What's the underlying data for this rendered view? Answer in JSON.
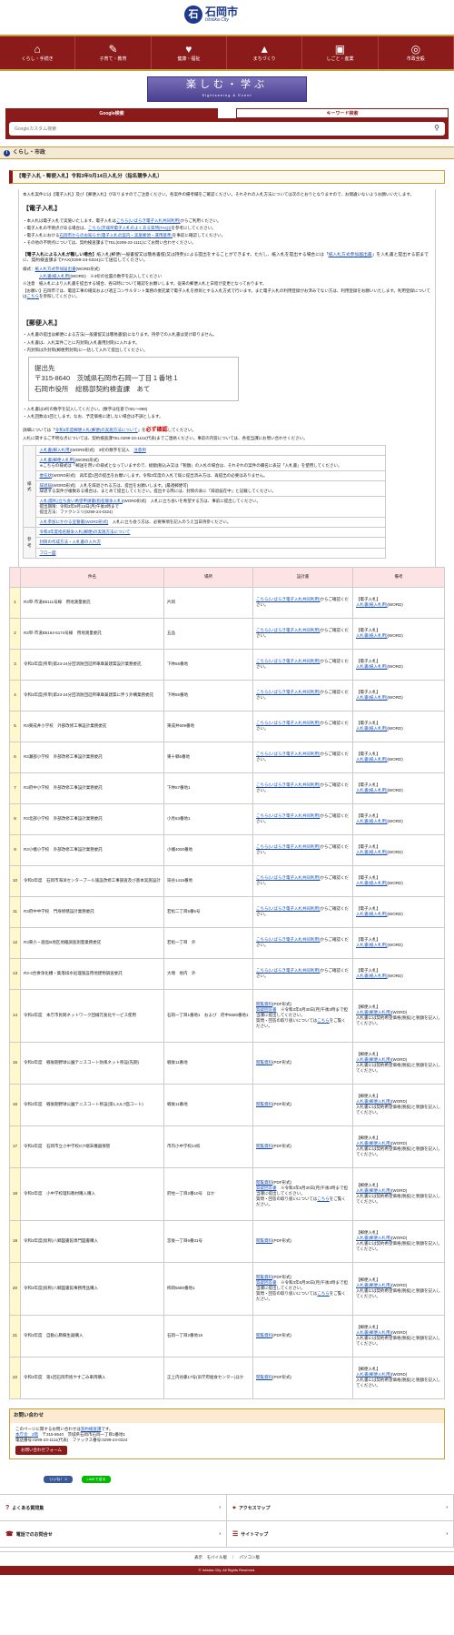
{
  "header": {
    "logo_mark": "石",
    "logo_jp": "石岡市",
    "logo_en": "Ishioka City"
  },
  "nav": [
    {
      "label": "くらし・手続き",
      "icon": "⌂"
    },
    {
      "label": "子育て・教育",
      "icon": "✎"
    },
    {
      "label": "健康・福祉",
      "icon": "♥"
    },
    {
      "label": "まちづくり",
      "icon": "▲"
    },
    {
      "label": "しごと・産業",
      "icon": "▣"
    },
    {
      "label": "市政全般",
      "icon": "◎"
    }
  ],
  "banner": {
    "title": "楽しむ・学ぶ",
    "sub": "Sightseeing & Event"
  },
  "search": {
    "tab1": "Google検索",
    "tab2": "キーワード検索",
    "placeholder": "Googleカスタム検索"
  },
  "breadcrumb": "くらし・市政",
  "page_title": "【電子入札・郵便入札】令和3年9月14日入札分（指名競争入札）",
  "intro": "本入札案件には【電子入札】及び【郵便入札】がありますのでご注意ください。各案件の備考欄をご確認ください。それぞれの入札方法については次のとおりとなりますので、お間違いないようお願いいたします。",
  "denshi": {
    "heading": "【電子入札】",
    "l1": "・本入札は電子入札で実施いたします。電子入札は",
    "l1_link": "こちら(いばらき電子入札共同利用)",
    "l1_tail": "からご利用ください。",
    "l2": "・電子入札の不明点がある場合は、",
    "l2_link": "こちら(茨城県電子入札のよくある質問(FAQ))",
    "l2_tail": "を参考にしてください。",
    "l3": "・電子入札における",
    "l3_link": "石岡市からのお知らせ(電子入札の案内・実施要領・運用基準)",
    "l3_tail": "を事前に確認してください。",
    "l4": "・その他の不明点については、契約検査課までTEL(0299-23-1111)にてお問い合わせください。",
    "k1": "【電子入札による入札が難しい場合】",
    "k1b": "紙入札(郵便(一般書留又は簡易書留)又は持参)による提出をすることができます。ただし、紙入札を提出する場合には「",
    "k1_link": "紙入札方式参加届出書",
    "k1c": "」を入札書と提出する前までに、契約検査課までFAX(0299-24-0324)にて送信してください。",
    "k2": "様式：",
    "k2_link": "紙入札方式参加届出書",
    "k2_tail": "(WORD形式)",
    "k3_link": "入札書(紙入札用)",
    "k3_tail": "(WORD)　※3桁の位置の数字を記入してください",
    "k4": "※注意　紙入札により入札書を提出する場合、各日時について確認をお願いします。従来の郵便入札と日程が変更となっております。",
    "k5": "【お願い】石岡市では、電話工事の確実および適正コンサルタント業務の委託業で電子入札を原則とする入札方式で行います。",
    "k5b": "また電子入札の利用登録がお済みでない方は、利用登録をお願いいたします。利用登録については",
    "k5_link": "こちら",
    "k5_tail": "を参照してください。"
  },
  "yubin": {
    "heading": "【郵便入札】",
    "l1": "・入札書の提出は郵便による方法(一般書留又は簡易書留)になります。持参での入札書は受け取りません。",
    "l2": "・入札書は、入札案件ごとに内封筒(入札書用封筒)に入れます。",
    "l3": "・内封筒は外封筒(郵便用封筒)に一括して入れて提出してください。",
    "addr1": "提出先",
    "addr2": "〒315-8640　茨城県石岡市石岡一丁目１番地１",
    "addr3": "石岡市役所　総務部契約検査課　あて",
    "l4": "・入札書は3桁の数字を記入してください。(数字は任意で001～999)",
    "l5": "・入札回数は1回とします。なお、予定価格に達しない場合は不調とします。",
    "l6": "詳細については「",
    "l6_link": "令和3年度郵便入札(郵便)の実施方法について",
    "l6_tail": "」を",
    "l6_red": "必ず確認",
    "l6_end": "してください。",
    "l7": "入札に関するご不明な点については、契約検査課TEL:0299-23-1111(代表)までご連絡ください。事前の内容については、各担当課にお問い合わせください。"
  },
  "forms": {
    "h1": "様式",
    "h2": "参考",
    "r1_link": "入札書(郵入札用)",
    "r1_tail": "(WORD形式)　3桁の数字を記入",
    "r1_link2": "注意例",
    "r2_link": "入札書(郵便入札用)",
    "r2_tail": "(WORD形式)",
    "r2_note": "※こちらの様式は「郵送を用いの様式となっていますので、総額(税込み又は「税額」の入札の場合は、それぞれの案件の欄名に表記「入札書」を使用してください。",
    "r3_link": "委任状",
    "r3_tail": "(WORD形式)　再年度1回の提出をお願いします。令和3年度の入札で既に提出済み方は、再提出の必要はありません。",
    "r4_link": "辞退届",
    "r4_tail": "(WORD形式)　入札を辞退される方は、提出をお願いします。(最適郵便可)",
    "r4_note": "辞退する案件が複数ある場合は、まとめて提出してください。提出する際には、封筒の表に「辞退届在中」と記載してください。",
    "r5_link": "入札(開札)立ち会い希望申請書(指名競争入札)",
    "r5_tail": "(WORD形式)　入札に立ち会いを希望する方は、事前に提出してください。",
    "r5_date": "提出期限：令和3年9月13日(月)午後3時まで",
    "r5_fax": "提出方法：ファクシミリ(0299-24-0324)",
    "r6_link": "入札参加にかかる宣誓書(WORD形式)",
    "r6_tail": "入札に立ち会う方は、必要事項を記入のうえ当日持参ください。",
    "ref1": "令和3年度指名競争入札(郵便)の実施方法について",
    "ref2": "封筒の作成方法・入札書の入れ方",
    "ref3": "フロー図"
  },
  "table": {
    "headers": [
      "",
      "件名",
      "場所",
      "設計書",
      "備考"
    ],
    "design_link": "こちら(いばらき電子入札共同利用)",
    "design_tail": "からご確認ください。",
    "doc_link": "閲覧資料",
    "doc_tail": "(PDF形式)",
    "q_link": "質疑回答書",
    "q_tail": "※令和3年8月30日(月)午後3時まで担当課に提出してください。",
    "q_more": "質問・回答の取り扱いについては",
    "q_more_link": "こちら",
    "q_more_tail": "をご覧ください。",
    "e_tag": "【電子入札】",
    "y_tag": "【郵便入札】",
    "e_link": "入札書(紙入札用)",
    "y_link": "入札書(郵便入札用)",
    "word": "(WORD)",
    "y_note": "入札書には契約希望価格(税抜)と税額を記入してください。",
    "rows": [
      {
        "no": "1",
        "name": "R3単-市道B0111号線　用地測量委託",
        "place": "片岡",
        "t": "e"
      },
      {
        "no": "2",
        "name": "R3単-市道B5164-5174号線　用地測量委託",
        "place": "五品",
        "t": "e"
      },
      {
        "no": "3",
        "name": "令和3年度(県単)第23-24分団消防団詰所車庫兼建築設計業務委託",
        "place": "下林55番地",
        "t": "e"
      },
      {
        "no": "4",
        "name": "令和3年度(県単)第23-24分団消防団詰所車庫兼建築に伴う外構業務委託",
        "place": "下林55番地",
        "t": "e"
      },
      {
        "no": "5",
        "name": "R3東成井小学校　外部改修工事設計業務委託",
        "place": "東成井609番地",
        "t": "e"
      },
      {
        "no": "6",
        "name": "R3瀬部小学校　外部改修工事設計業務委託",
        "place": "東十郷6番地",
        "t": "e"
      },
      {
        "no": "7",
        "name": "R3府中小学校　外部改修工事設計業務委託",
        "place": "下林57番地1",
        "t": "e"
      },
      {
        "no": "8",
        "name": "R3北部小学校　外部改修工事設計業務委託",
        "place": "小見63番地1",
        "t": "e"
      },
      {
        "no": "9",
        "name": "R3小幡小学校　外部改修工事設計業務委託",
        "place": "小幡4000番地",
        "t": "e"
      },
      {
        "no": "10",
        "name": "令和3年度　石岡市海洋センタープール施設改修工事調査及び基本実施設計",
        "place": "染谷1415番地",
        "t": "e"
      },
      {
        "no": "11",
        "name": "R3府中中学校　門扉修繕設計業務委託",
        "place": "若松二丁目5番5号",
        "t": "e"
      },
      {
        "no": "12",
        "name": "R3東小・鹿島B地区地籍調査測量業務委託",
        "place": "若松一丁目　外",
        "t": "e"
      },
      {
        "no": "13",
        "name": "R3-3合併浄化槽・集落排水処理施設用地建物調査委託",
        "place": "大増　他内　外",
        "t": "e"
      },
      {
        "no": "14",
        "name": "令和3年度　本庁市民間ネットワーク回線冗長化サービス使用",
        "place": "石岡一丁目1番地1　および　府中5680番地1",
        "t": "y3"
      },
      {
        "no": "15",
        "name": "令和3年度　戦後期野球公園テニスコート防風ネット移設(先期)",
        "place": "戦後11番地",
        "t": "y1"
      },
      {
        "no": "16",
        "name": "令和3年度　戦後期野球公園テニスコート移設(第1,4,5,7面コート)",
        "place": "戦後11番地",
        "t": "y1"
      },
      {
        "no": "17",
        "name": "令和3年度　石岡市立小中学校ICT端末機器保管",
        "place": "市内小中学校24校",
        "t": "y1"
      },
      {
        "no": "18",
        "name": "令和3年度　小中学校理科教材購入購入",
        "place": "府柱一丁目2番10号　ほか",
        "t": "y3"
      },
      {
        "no": "19",
        "name": "令和3年度(仮称)八郷図書館専門図書購入",
        "place": "宮後一丁目6番31号",
        "t": "y1"
      },
      {
        "no": "20",
        "name": "令和3年度(仮称)八郷図書館事務用品購入",
        "place": "柿岡5680番地1",
        "t": "y3"
      },
      {
        "no": "21",
        "name": "令和3年度　自動心肺蘇生器購入",
        "place": "石岡一丁目2番地18",
        "t": "y1"
      },
      {
        "no": "22",
        "name": "令和3年度　第1回石岡市捨やすごみ車両購入",
        "place": "正上内谷藤17号(旧学府給食センター)ほか",
        "t": "y1"
      }
    ]
  },
  "contact": {
    "heading": "お問い合わせ",
    "l1": "このページに関するお問い合わせは",
    "l1_link": "契約検査課",
    "l1_tail": "です。",
    "l2_link": "本庁舎　2階",
    "l2": "〒315-8640　茨城県石岡市石岡一丁目1番地1",
    "l3": "電話番号:0299-23-1111(代表)　ファックス番号:0299-24-0324",
    "btn": "お問い合わせフォーム"
  },
  "sns": {
    "fb": "いいね！ 0",
    "line": "LINEで送る",
    "fb_color": "#3b5998",
    "line_color": "#00b900"
  },
  "footer": {
    "links": [
      {
        "label": "よくある質問集",
        "icon": "?"
      },
      {
        "label": "アクセスマップ",
        "icon": "⌖"
      },
      {
        "label": "電話でのお問合せ",
        "icon": "☎"
      },
      {
        "label": "サイトマップ",
        "icon": "☰"
      }
    ],
    "view": "表示　モバイル版　｜　パソコン版",
    "copyright": "© Ishioka City. All Rights Reserved."
  }
}
